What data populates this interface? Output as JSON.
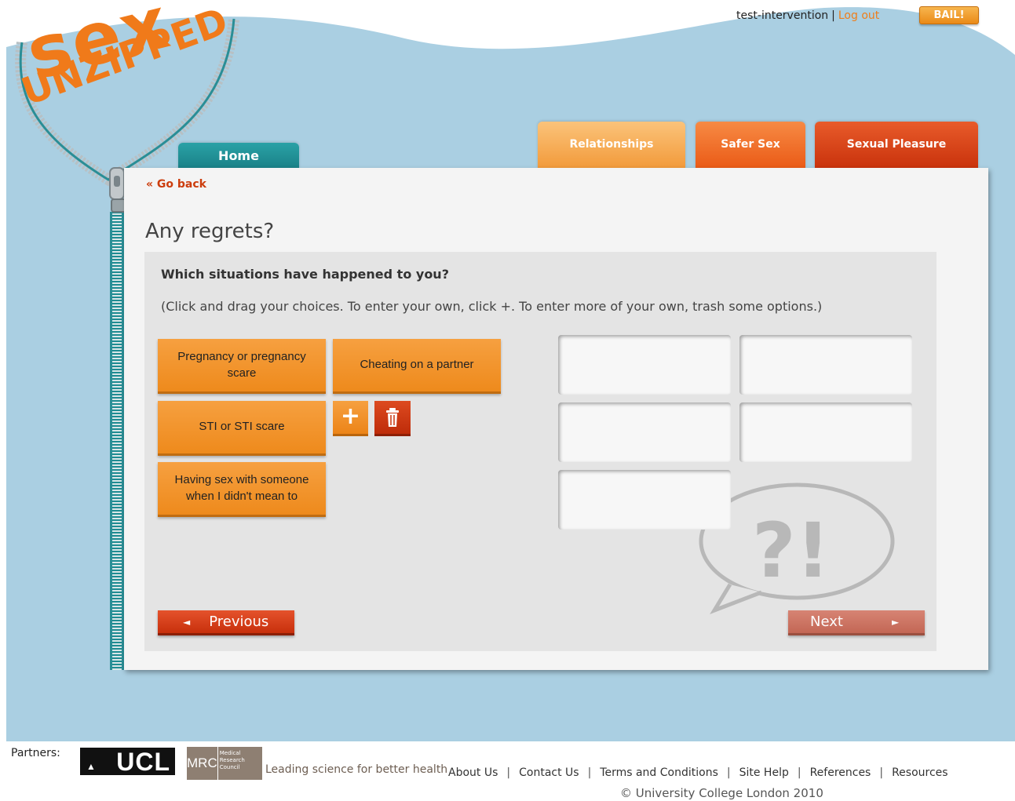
{
  "header": {
    "username": "test-intervention",
    "separator": "|",
    "logout_label": "Log out",
    "bail_label": "BAIL!"
  },
  "logo": {
    "line1": "sex",
    "line2": "UNZIPPED"
  },
  "nav": {
    "home": "Home",
    "tabs": [
      {
        "label": "Relationships"
      },
      {
        "label": "Safer Sex"
      },
      {
        "label": "Sexual Pleasure"
      }
    ]
  },
  "page": {
    "go_back": "« Go back",
    "title": "Any regrets?",
    "question": "Which situations have happened to you?",
    "instructions": "(Click and drag your choices. To enter your own, click +. To enter more of your own, trash some options.)",
    "choices": [
      "Pregnancy or pregnancy scare",
      "Cheating on a partner",
      "STI or STI scare",
      "Having sex with someone when I didn't mean to"
    ],
    "add_symbol": "+",
    "previous_label": "Previous",
    "next_label": "Next",
    "prev_arrow": "◄",
    "next_arrow": "►",
    "graphic_text": "?!"
  },
  "footer": {
    "partners_label": "Partners:",
    "ucl": "UCL",
    "mrc_abbr": "MRC",
    "mrc_full": "Medical Research Council",
    "mrc_tagline": "Leading science for better health",
    "links": [
      "About Us",
      "Contact Us",
      "Terms and Conditions",
      "Site Help",
      "References",
      "Resources"
    ],
    "copyright": "© University College London 2010"
  },
  "colors": {
    "sky": "#aacfe2",
    "teal": "#1e8c92",
    "orange": "#ef8a1e",
    "red": "#c9320c"
  }
}
